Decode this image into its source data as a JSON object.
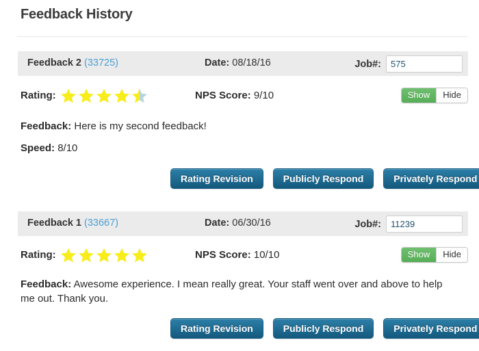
{
  "page": {
    "title": "Feedback History"
  },
  "labels": {
    "date_label": "Date:",
    "job_label": "Job#:",
    "rating_label": "Rating:",
    "nps_label": "NPS Score:",
    "feedback_label": "Feedback:",
    "speed_label": "Speed:",
    "show_label": "Show",
    "hide_label": "Hide"
  },
  "colors": {
    "star_filled": "#f7ed1c",
    "star_empty": "#b8d4dd",
    "button_blue_top": "#2c7fa8",
    "button_blue_bottom": "#14597d",
    "toggle_green": "#57ad57",
    "header_gray": "#ebebeb",
    "link_blue": "#4a9fd4"
  },
  "buttons": {
    "rating_revision": "Rating Revision",
    "publicly_respond": "Publicly Respond",
    "privately_respond": "Privately Respond"
  },
  "feedbacks": [
    {
      "name": "Feedback 2",
      "id": "(33725)",
      "date": "08/18/16",
      "job_number": "575",
      "rating_stars": 4.5,
      "nps": "9/10",
      "feedback_text": "Here is my second feedback!",
      "speed": "8/10",
      "toggle_selected": "Show"
    },
    {
      "name": "Feedback 1",
      "id": "(33667)",
      "date": "06/30/16",
      "job_number": "11239",
      "rating_stars": 5,
      "nps": "10/10",
      "feedback_text": "Awesome experience. I mean really great. Your staff went over and above to help me out. Thank you.",
      "speed": null,
      "toggle_selected": "Show"
    }
  ]
}
